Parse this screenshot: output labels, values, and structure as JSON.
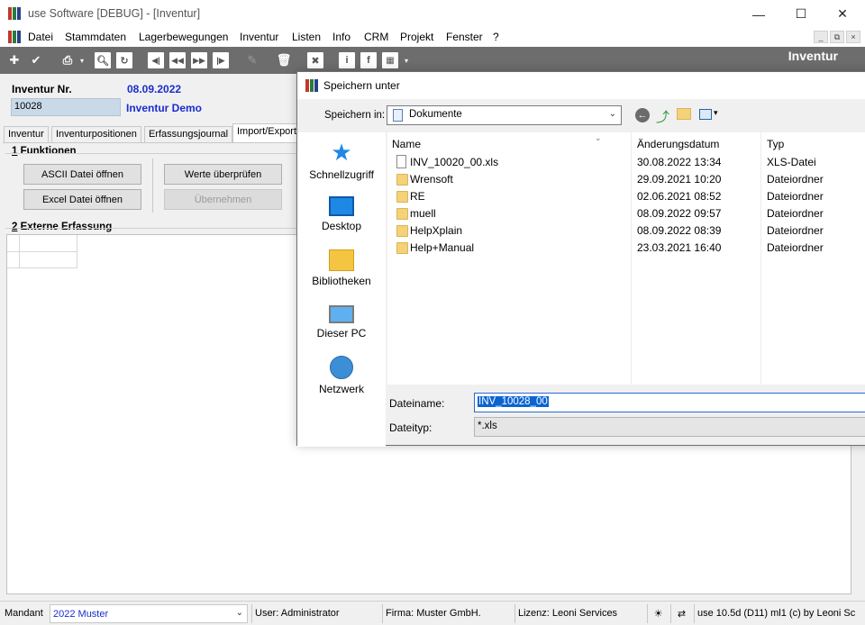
{
  "window": {
    "title": "use Software [DEBUG] - [Inventur]"
  },
  "menu": {
    "items": [
      "Datei",
      "Stammdaten",
      "Lagerbewegungen",
      "Inventur",
      "Listen",
      "Info",
      "CRM",
      "Projekt",
      "Fenster",
      "?"
    ]
  },
  "toolbar": {
    "module_title": "Inventur",
    "icons": [
      "add-icon",
      "check-icon",
      "print-icon",
      "search-icon",
      "refresh-icon",
      "first-record-icon",
      "previous-record-icon",
      "next-record-icon",
      "last-record-icon",
      "edit-icon",
      "delete-icon",
      "close-icon",
      "info-icon",
      "facebook-icon",
      "grid-icon"
    ]
  },
  "form": {
    "inventur_nr_label": "Inventur Nr.",
    "inventur_nr_value": "10028",
    "date": "08.09.2022",
    "name": "Inventur Demo"
  },
  "tabs": [
    "Inventur",
    "Inventurpositionen",
    "Erfassungsjournal",
    "Import/Export"
  ],
  "active_tab": "Import/Export",
  "funktionen": {
    "title_num": "1",
    "title": "Funktionen",
    "btn_ascii": "ASCII Datei öffnen",
    "btn_excel": "Excel Datei öffnen",
    "btn_check": "Werte überprüfen",
    "btn_apply": "Übernehmen"
  },
  "externe": {
    "title_num": "2",
    "title": "Externe Erfassung"
  },
  "statusbar": {
    "mandant_label": "Mandant",
    "mandant_value": "2022 Muster",
    "user": "User: Administrator",
    "firma": "Firma: Muster GmbH.",
    "lizenz": "Lizenz: Leoni Services",
    "version": "use 10.5d (D11) ml1 (c) by Leoni Sc"
  },
  "dialog": {
    "title": "Speichern unter",
    "save_in_label": "Speichern in:",
    "save_in_value": "Dokumente",
    "places": [
      "Schnellzugriff",
      "Desktop",
      "Bibliotheken",
      "Dieser PC",
      "Netzwerk"
    ],
    "columns": {
      "name": "Name",
      "date": "Änderungsdatum",
      "type": "Typ"
    },
    "files": [
      {
        "name": "INV_10020_00.xls",
        "date": "30.08.2022 13:34",
        "type": "XLS-Datei",
        "kind": "file"
      },
      {
        "name": "Wrensoft",
        "date": "29.09.2021 10:20",
        "type": "Dateiordner",
        "kind": "folder"
      },
      {
        "name": "RE",
        "date": "02.06.2021 08:52",
        "type": "Dateiordner",
        "kind": "folder"
      },
      {
        "name": "muell",
        "date": "08.09.2022 09:57",
        "type": "Dateiordner",
        "kind": "folder"
      },
      {
        "name": "HelpXplain",
        "date": "08.09.2022 08:39",
        "type": "Dateiordner",
        "kind": "folder"
      },
      {
        "name": "Help+Manual",
        "date": "23.03.2021 16:40",
        "type": "Dateiordner",
        "kind": "folder"
      }
    ],
    "filename_label": "Dateiname:",
    "filename_value": "INV_10028_00",
    "filetype_label": "Dateityp:",
    "filetype_value": "*.xls"
  }
}
